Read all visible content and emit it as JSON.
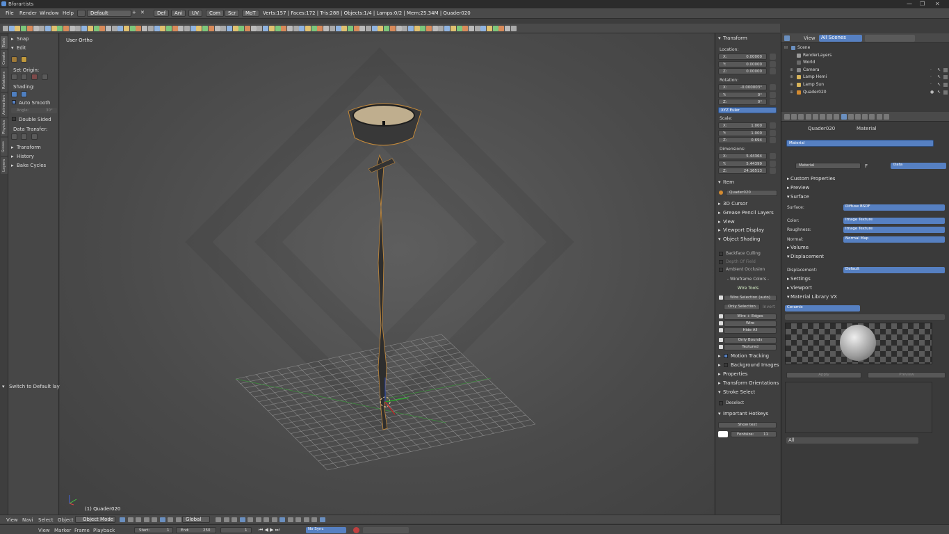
{
  "window": {
    "title": "Bforartists",
    "controls": [
      "—",
      "❐",
      "✕"
    ]
  },
  "menubar": {
    "items": [
      "File",
      "Render",
      "Window",
      "Help"
    ],
    "layout": "Default",
    "tabs": [
      "Def",
      "Ani",
      "UV",
      "Com",
      "Scr",
      "MoT"
    ],
    "stats": "Verts:157 | Faces:172 | Tris:288 | Objects:1/4 | Lamps:0/2 | Mem:25.34M | Quader020"
  },
  "left_tabs": [
    "Tools",
    "Create",
    "Relations",
    "Animation",
    "Physics",
    "Grease Pencil",
    "Layers"
  ],
  "tool_panel": {
    "snap": "Snap",
    "edit": "Edit",
    "set_origin": "Set Origin:",
    "shading": "Shading:",
    "auto_smooth": "Auto Smooth",
    "angle": "Angle:",
    "angle_val": "30°",
    "double_sided": "Double Sided",
    "data_transfer": "Data Transfer:",
    "transform": "Transform",
    "history": "History",
    "bake_cycles": "Bake Cycles",
    "switch_default": "Switch to Default layout"
  },
  "viewport": {
    "label": "User Ortho",
    "object_label": "(1) Quader020"
  },
  "npanel": {
    "transform": "Transform",
    "location": "Location:",
    "loc": [
      {
        "axis": "X:",
        "v": "0.00000"
      },
      {
        "axis": "Y:",
        "v": "0.00000"
      },
      {
        "axis": "Z:",
        "v": "0.00000"
      }
    ],
    "rotation": "Rotation:",
    "rot": [
      {
        "axis": "X:",
        "v": "-0.000003°"
      },
      {
        "axis": "Y:",
        "v": "0°"
      },
      {
        "axis": "Z:",
        "v": "0°"
      }
    ],
    "rot_mode": "XYZ Euler",
    "scale": "Scale:",
    "scl": [
      {
        "axis": "X:",
        "v": "1.000"
      },
      {
        "axis": "Y:",
        "v": "1.000"
      },
      {
        "axis": "Z:",
        "v": "0.694"
      }
    ],
    "dimensions": "Dimensions:",
    "dim": [
      {
        "axis": "X:",
        "v": "5.44364"
      },
      {
        "axis": "Y:",
        "v": "5.44399"
      },
      {
        "axis": "Z:",
        "v": "24.16513"
      }
    ],
    "item": "Item",
    "item_name": "Quader020",
    "sections": [
      "3D Cursor",
      "Grease Pencil Layers",
      "View",
      "Viewport Display",
      "Object Shading"
    ],
    "backface": "Backface Culling",
    "dof": "Depth Of Field",
    "ao": "Ambient Occlusion",
    "wire_colors": "- Wireframe Colors -",
    "wire_tools": "Wire Tools",
    "wire_sel": "Wire Selection (auto)",
    "only_sel": "Only Selection",
    "invert": "Invert",
    "wire_edges": "Wire + Edges",
    "wire": "Wire",
    "hide_all": "Hide All",
    "only_bounds": "Only Bounds",
    "textured": "Textured",
    "sections2": [
      "Motion Tracking",
      "Background Images",
      "Properties",
      "Transform Orientations",
      "Stroke Select"
    ],
    "deselect": "Deselect",
    "hotkeys": "Important Hotkeys",
    "show_text": "Show text",
    "fontsize": "Fontsize:",
    "fontsize_val": "11"
  },
  "outliner": {
    "view": "View",
    "scenes": "All Scenes",
    "items": [
      {
        "name": "Scene",
        "indent": 0
      },
      {
        "name": "RenderLayers",
        "indent": 1
      },
      {
        "name": "World",
        "indent": 1
      },
      {
        "name": "Camera",
        "indent": 1
      },
      {
        "name": "Lamp Hemi",
        "indent": 1
      },
      {
        "name": "Lamp Sun",
        "indent": 1
      },
      {
        "name": "Quader020",
        "indent": 1
      }
    ]
  },
  "properties": {
    "crumb_obj": "Quader020",
    "crumb_mat": "Material",
    "slot": "Material",
    "mat_name": "Material",
    "mat_f": "F",
    "data": "Data",
    "custom_props": "Custom Properties",
    "preview": "Preview",
    "surface": "Surface",
    "surface_lbl": "Surface:",
    "surface_val": "Diffuse BSDF",
    "color_lbl": "Color:",
    "color_val": "Image Texture",
    "rough_lbl": "Roughness:",
    "rough_val": "Image Texture",
    "normal_lbl": "Normal:",
    "normal_val": "Normal Map",
    "volume": "Volume",
    "displacement": "Displacement",
    "disp_lbl": "Displacement:",
    "disp_val": "Default",
    "settings": "Settings",
    "viewport": "Viewport",
    "matlib": "Material Library VX",
    "lib": "Ceramic",
    "apply": "Apply",
    "preview_btn": "Preview",
    "all": "All"
  },
  "bottom": {
    "menus": [
      "View",
      "Navi",
      "Select",
      "Object"
    ],
    "mode": "Object Mode",
    "orient": "Global"
  },
  "timeline": {
    "menus": [
      "View",
      "Marker",
      "Frame",
      "Playback"
    ],
    "start_lbl": "Start:",
    "start": "1",
    "end_lbl": "End:",
    "end": "250",
    "frame": "1",
    "sync": "No Sync"
  }
}
